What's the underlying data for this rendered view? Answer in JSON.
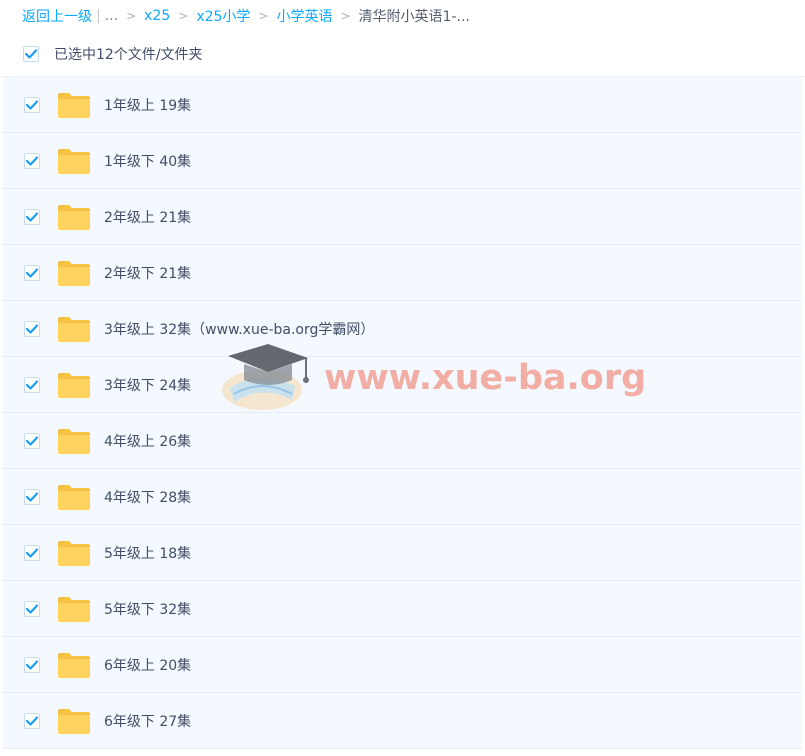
{
  "breadcrumb": {
    "back_label": "返回上一级",
    "pipe": "|",
    "more": "...",
    "separator": ">",
    "items": [
      "x25",
      "x25小学",
      "小学英语"
    ],
    "current": "清华附小英语1-..."
  },
  "selection": {
    "label": "已选中12个文件/文件夹",
    "all_checked": true
  },
  "folders": [
    {
      "name": "1年级上 19集",
      "checked": true
    },
    {
      "name": "1年级下 40集",
      "checked": true
    },
    {
      "name": "2年级上 21集",
      "checked": true
    },
    {
      "name": "2年级下 21集",
      "checked": true
    },
    {
      "name": "3年级上 32集（www.xue-ba.org学霸网）",
      "checked": true
    },
    {
      "name": "3年级下 24集",
      "checked": true
    },
    {
      "name": "4年级上 26集",
      "checked": true
    },
    {
      "name": "4年级下 28集",
      "checked": true
    },
    {
      "name": "5年级上 18集",
      "checked": true
    },
    {
      "name": "5年级下 32集",
      "checked": true
    },
    {
      "name": "6年级上 20集",
      "checked": true
    },
    {
      "name": "6年级下 27集",
      "checked": true
    }
  ],
  "watermark": {
    "text": "www.xue-ba.org"
  },
  "colors": {
    "accent": "#09aaff",
    "row_bg": "#f3f9fe",
    "folder": "#ffd35e",
    "check": "#1c9df2"
  },
  "icons": {
    "checkbox": "check-icon",
    "folder": "folder-icon",
    "watermark_logo": "graduation-cap-icon"
  }
}
